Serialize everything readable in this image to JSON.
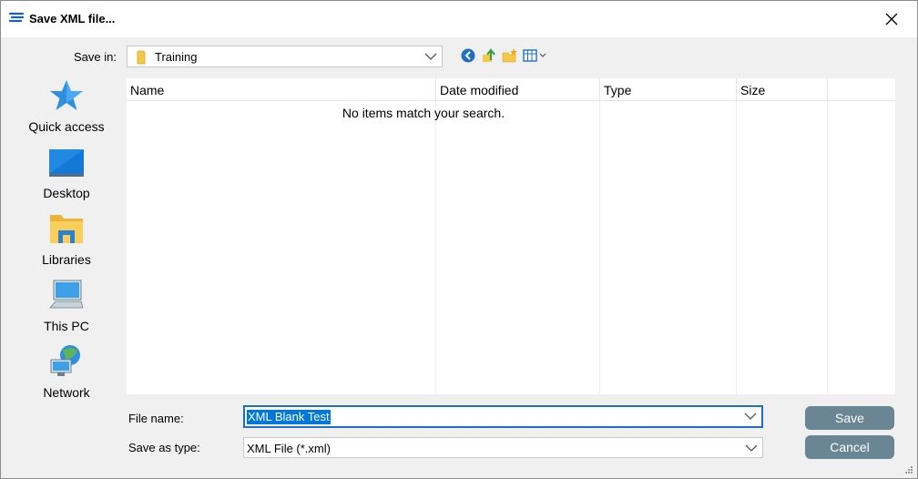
{
  "window": {
    "title": "Save XML file..."
  },
  "save_in": {
    "label": "Save in:",
    "value": "Training"
  },
  "places": [
    {
      "label": "Quick access",
      "icon": "star-icon"
    },
    {
      "label": "Desktop",
      "icon": "desktop-icon"
    },
    {
      "label": "Libraries",
      "icon": "libraries-icon"
    },
    {
      "label": "This PC",
      "icon": "computer-icon"
    },
    {
      "label": "Network",
      "icon": "network-icon"
    }
  ],
  "file_list": {
    "columns": [
      "Name",
      "Date modified",
      "Type",
      "Size"
    ],
    "empty_message": "No items match your search."
  },
  "file_name": {
    "label": "File name:",
    "value": "XML Blank Test"
  },
  "save_as_type": {
    "label": "Save as type:",
    "value": "XML File (*.xml)"
  },
  "buttons": {
    "save": "Save",
    "cancel": "Cancel"
  },
  "colors": {
    "accent": "#0078d7",
    "button": "#6a8694"
  }
}
